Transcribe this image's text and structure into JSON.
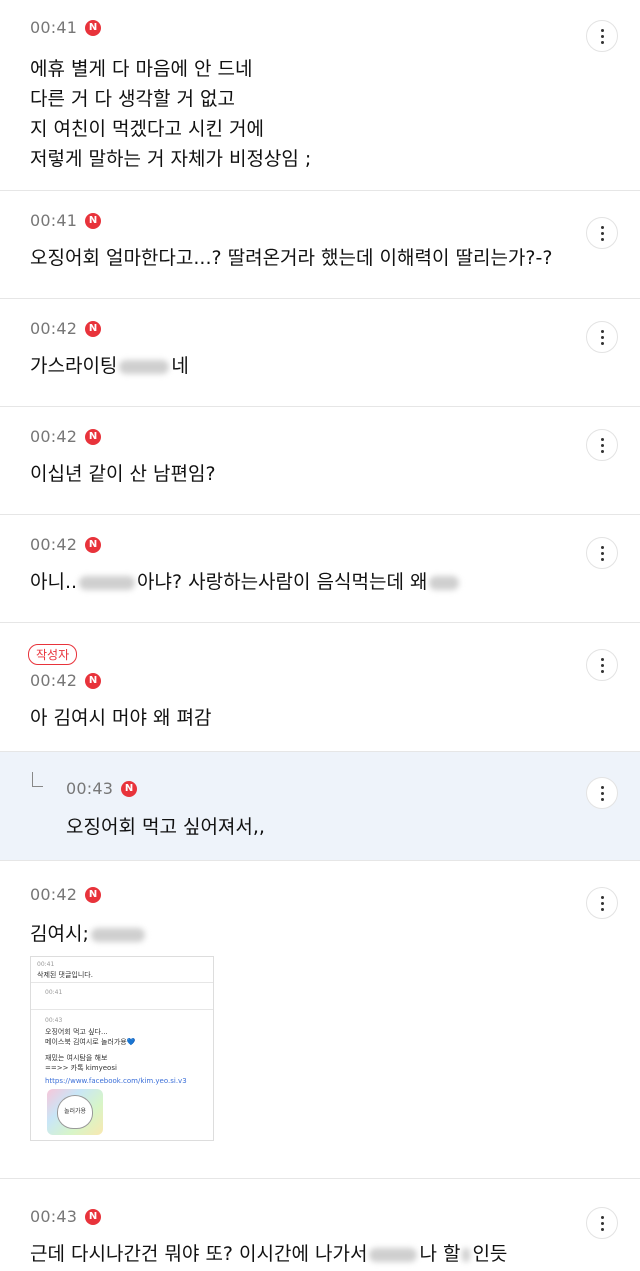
{
  "comments": [
    {
      "time": "00:41",
      "badge": "N",
      "lines": [
        "에휴 별게 다 마음에 안 드네",
        "다른 거 다 생각할 거 없고",
        "지 여친이 먹겠다고 시킨 거에",
        "저렇게 말하는 거 자체가 비정상임 ;"
      ]
    },
    {
      "time": "00:41",
      "badge": "N",
      "lines": [
        "오징어회 얼마한다고...? 딸려온거라 했는데 이해력이 딸리는가?-?"
      ]
    },
    {
      "time": "00:42",
      "badge": "N",
      "text_a": "가스라이팅",
      "text_b": "네"
    },
    {
      "time": "00:42",
      "badge": "N",
      "lines": [
        "이십년 같이 산 남편임?"
      ]
    },
    {
      "time": "00:42",
      "badge": "N",
      "text_a": "아니..",
      "text_b": "아냐? 사랑하는사람이 음식먹는데 왜",
      "text_c": ""
    },
    {
      "author_label": "작성자",
      "time": "00:42",
      "badge": "N",
      "lines": [
        "아 김여시 머야 왜 펴감"
      ]
    },
    {
      "time": "00:43",
      "badge": "N",
      "lines": [
        "오징어회 먹고 싶어져서,,"
      ]
    },
    {
      "time": "00:42",
      "badge": "N",
      "text_a": "김여시;",
      "text_b": ""
    },
    {
      "time": "00:43",
      "badge": "N",
      "text_a": "근데 다시나간건 뭐야 또? 이시간에 나가서",
      "text_b": "나 할",
      "text_c": "인듯"
    }
  ],
  "embed": {
    "time1": "00:41",
    "deleted": "삭제된 댓글입니다.",
    "time2": "00:41",
    "time3": "00:43",
    "lines": [
      "오징어회 먹고 싶다...",
      "메이스북 김여시로 놀러가용💙",
      "",
      "재밌는 여시탐을 해보",
      "==>> 카톡 kimyeosi"
    ],
    "link": "https://www.facebook.com/kim.yeo.si.v3",
    "sticker": "놀러가용"
  }
}
